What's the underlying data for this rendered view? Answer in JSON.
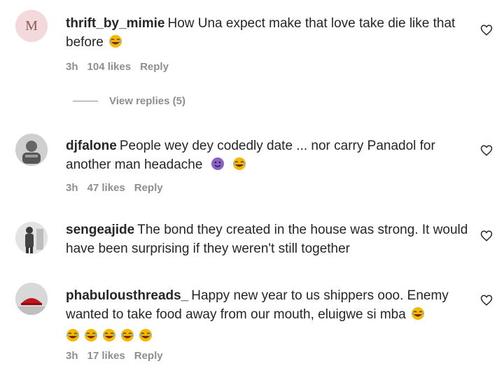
{
  "comments": [
    {
      "username": "thrift_by_mimie",
      "text": "How Una expect make that love take die like that before",
      "time": "3h",
      "likes": "104 likes",
      "reply": "Reply",
      "avatar_letter": "M",
      "emojis": [
        "laughing-emoji"
      ]
    },
    {
      "username": "djfalone",
      "text": "People wey dey codedly date ... nor carry Panadol for another man headache",
      "time": "3h",
      "likes": "47 likes",
      "reply": "Reply",
      "emojis": [
        "purple-smiley-emoji",
        "laughing-emoji"
      ]
    },
    {
      "username": "sengeajide",
      "text": "The bond they created in the house was strong. It would have been surprising if they weren't still together",
      "emojis": []
    },
    {
      "username": "phabulousthreads_",
      "text": "Happy new year to us shippers ooo. Enemy wanted to take food away from our mouth, eluigwe si mba",
      "time": "3h",
      "likes": "17 likes",
      "reply": "Reply",
      "emojis": [
        "laughing-emoji",
        "laughing-emoji",
        "laughing-emoji",
        "laughing-emoji",
        "laughing-emoji",
        "laughing-emoji"
      ]
    }
  ],
  "view_replies": "View replies (5)",
  "colors": {
    "text": "#262626",
    "meta": "#8e8e8e",
    "avatar_pink": "#f3d9dc",
    "emoji_yellow": "#f5b800",
    "emoji_purple": "#8a63c7"
  }
}
